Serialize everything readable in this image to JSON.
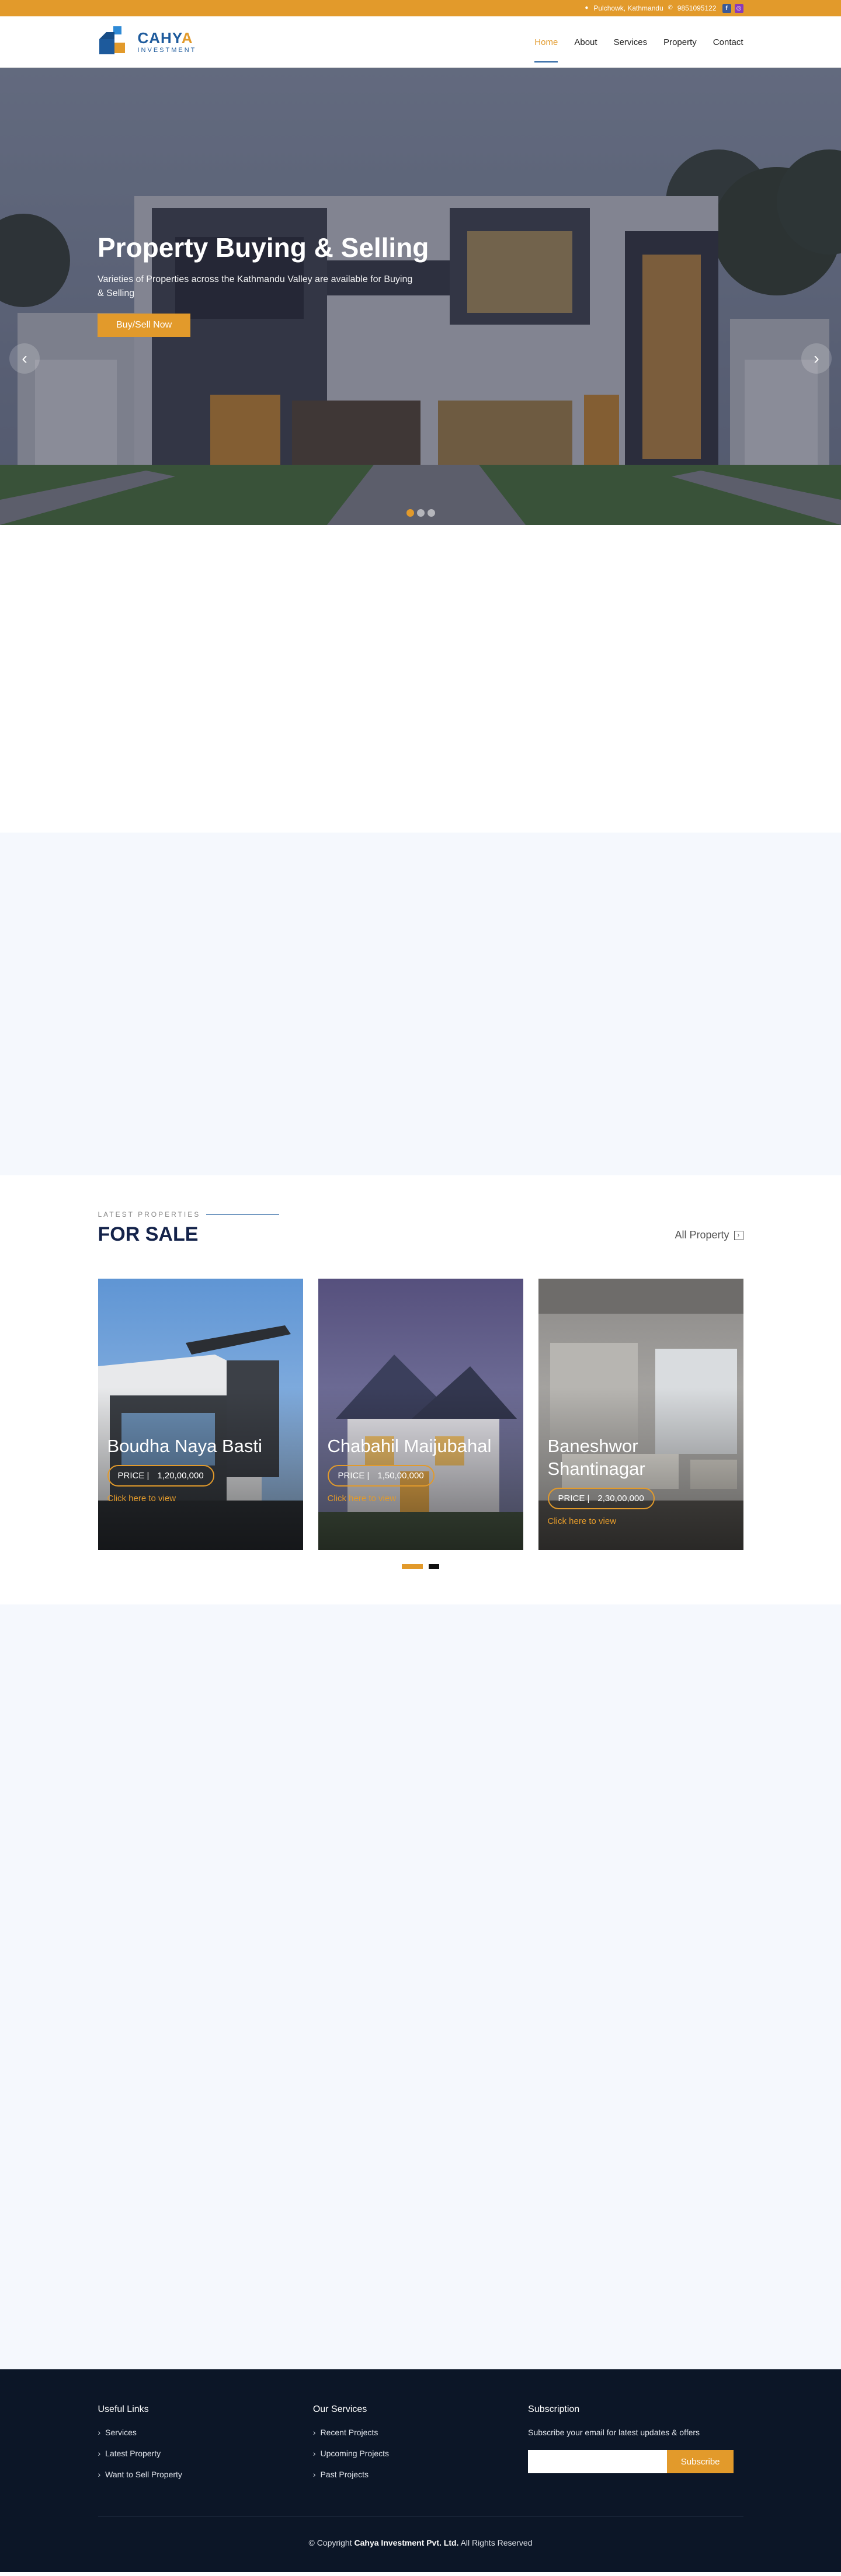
{
  "topbar": {
    "location": "Pulchowk, Kathmandu",
    "phone": "9851095122",
    "facebook_label": "f",
    "instagram_label": "◎"
  },
  "brand": {
    "name_main": "CAHY",
    "name_accent": "A",
    "tagline": "INVESTMENT",
    "colors": {
      "primary": "#1d5a9c",
      "accent": "#e29a2b",
      "dark": "#14234a"
    }
  },
  "nav": {
    "items": [
      "Home",
      "About",
      "Services",
      "Property",
      "Contact"
    ],
    "active": "Home"
  },
  "hero": {
    "title": "Property Buying & Selling",
    "subtitle": "Varieties of Properties across the Kathmandu Valley are available for Buying & Selling",
    "button": "Buy/Sell Now",
    "prev_icon": "chevron-left-icon",
    "next_icon": "chevron-right-icon",
    "slide_count": 3,
    "active_slide": 1
  },
  "properties": {
    "kicker": "LATEST PROPERTIES",
    "title": "FOR SALE",
    "all_link": "All Property",
    "price_label": "PRICE",
    "link_text": "Click here to view",
    "items": [
      {
        "name": "Boudha Naya Basti",
        "price": "1,20,00,000"
      },
      {
        "name": "Chabahil Maijubahal",
        "price": "1,50,00,000"
      },
      {
        "name": "Baneshwor Shantinagar",
        "price": "2,30,00,000"
      }
    ]
  },
  "footer": {
    "links_title": "Useful Links",
    "links": [
      "Services",
      "Latest Property",
      "Want to Sell Property"
    ],
    "services_title": "Our Services",
    "services": [
      "Recent Projects",
      "Upcoming Projects",
      "Past Projects"
    ],
    "subscription_title": "Subscription",
    "subscription_text": "Subscribe your email for latest updates & offers",
    "subscribe_button": "Subscribe",
    "email_placeholder": "",
    "copyright_prefix": "© Copyright",
    "company": "Cahya Investment Pvt. Ltd.",
    "copyright_suffix": "All Rights Reserved"
  }
}
